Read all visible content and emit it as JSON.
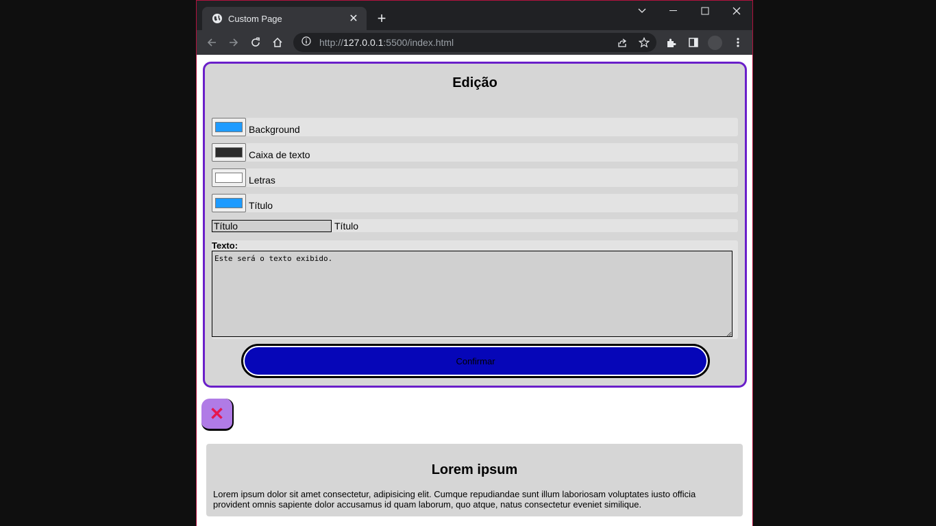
{
  "tab": {
    "title": "Custom Page",
    "close": "✕"
  },
  "newtab": "+",
  "address": {
    "scheme": "http://",
    "host": "127.0.0.1",
    "rest": ":5500/index.html"
  },
  "editor": {
    "title": "Edição",
    "colors": [
      {
        "label": "Background",
        "value": "#1e9bff"
      },
      {
        "label": "Caixa de texto",
        "value": "#2b2b2b"
      },
      {
        "label": "Letras",
        "value": "#ffffff"
      },
      {
        "label": "Título",
        "value": "#1e9bff"
      }
    ],
    "title_input": {
      "value": "Título",
      "label": "Título"
    },
    "texto_label": "Texto:",
    "texto_value": "Este será o texto exibido.",
    "confirm_label": "Confirmar"
  },
  "close_fab": "✕",
  "card": {
    "title": "Lorem ipsum",
    "text": "Lorem ipsum dolor sit amet consectetur, adipisicing elit. Cumque repudiandae sunt illum laboriosam voluptates iusto officia provident omnis sapiente dolor accusamus id quam laborum, quo atque, natus consectetur eveniet similique."
  },
  "colors": {
    "accent_border": "#6a1fc9",
    "confirm_fill": "#0606b8",
    "fab_fill": "#b07be6",
    "fab_x": "#e5174e"
  }
}
